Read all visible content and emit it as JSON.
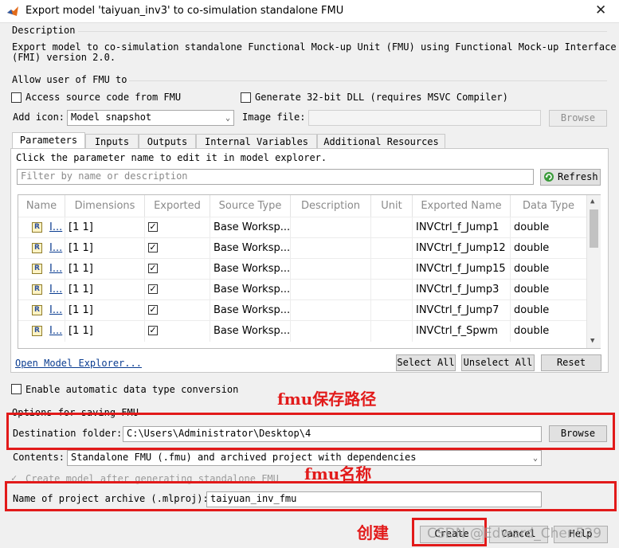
{
  "window": {
    "title": "Export model 'taiyuan_inv3' to co-simulation standalone FMU",
    "close_glyph": "✕"
  },
  "description": {
    "header": "Description",
    "line1": "Export model to co-simulation standalone Functional Mock-up Unit (FMU) using Functional Mock-up Interface",
    "line2": "(FMI) version 2.0."
  },
  "allow": {
    "header": "Allow user of FMU to",
    "access_source": "Access source code from FMU",
    "gen_32bit": "Generate 32-bit DLL (requires MSVC Compiler)"
  },
  "icon_row": {
    "add_icon_label": "Add icon:",
    "add_icon_value": "Model snapshot",
    "image_file_label": "Image file:",
    "browse": "Browse"
  },
  "tabs": [
    "Parameters",
    "Inputs",
    "Outputs",
    "Internal Variables",
    "Additional Resources"
  ],
  "params": {
    "hint": "Click the parameter name to edit it in model explorer.",
    "filter_placeholder": "Filter by name or description",
    "refresh": "Refresh"
  },
  "table": {
    "columns": [
      "Name",
      "Dimensions",
      "Exported",
      "Source Type",
      "Description",
      "Unit",
      "Exported Name",
      "Data Type"
    ],
    "rows": [
      {
        "name": "I...",
        "dim": "[1 1]",
        "exported": "✓",
        "source": "Base Worksp...",
        "export_name": "INVCtrl_f_Jump1",
        "type": "double"
      },
      {
        "name": "I...",
        "dim": "[1 1]",
        "exported": "✓",
        "source": "Base Worksp...",
        "export_name": "INVCtrl_f_Jump12",
        "type": "double"
      },
      {
        "name": "I...",
        "dim": "[1 1]",
        "exported": "✓",
        "source": "Base Worksp...",
        "export_name": "INVCtrl_f_Jump15",
        "type": "double"
      },
      {
        "name": "I...",
        "dim": "[1 1]",
        "exported": "✓",
        "source": "Base Worksp...",
        "export_name": "INVCtrl_f_Jump3",
        "type": "double"
      },
      {
        "name": "I...",
        "dim": "[1 1]",
        "exported": "✓",
        "source": "Base Worksp...",
        "export_name": "INVCtrl_f_Jump7",
        "type": "double"
      },
      {
        "name": "I...",
        "dim": "[1 1]",
        "exported": "✓",
        "source": "Base Worksp...",
        "export_name": "INVCtrl_f_Spwm",
        "type": "double"
      }
    ],
    "param_icon": "R"
  },
  "table_buttons": {
    "open_explorer": "Open Model Explorer...",
    "select_all": "Select All",
    "unselect_all": "Unselect All",
    "reset": "Reset"
  },
  "auto_convert": "Enable automatic data type conversion",
  "saving": {
    "header": "Options for saving FMU",
    "dest_label": "Destination folder:",
    "dest_value": "C:\\Users\\Administrator\\Desktop\\4",
    "browse": "Browse",
    "contents_label": "Contents:",
    "contents_value": "Standalone FMU (.fmu) and archived project with dependencies",
    "create_model": "Create model after generating standalone FMU",
    "archive_label": "Name of project archive (.mlproj):",
    "archive_value": "taiyuan_inv_fmu"
  },
  "footer": {
    "create": "Create",
    "cancel": "Cancel",
    "help": "Help"
  },
  "annotations": {
    "fmu_save_path": "fmu保存路径",
    "fmu_name": "fmu名称",
    "create": "创建"
  },
  "watermark": "CSDN @Edward_Chen529",
  "colors": {
    "annotation_red": "#e21a1a",
    "link_blue": "#0b3d91"
  }
}
